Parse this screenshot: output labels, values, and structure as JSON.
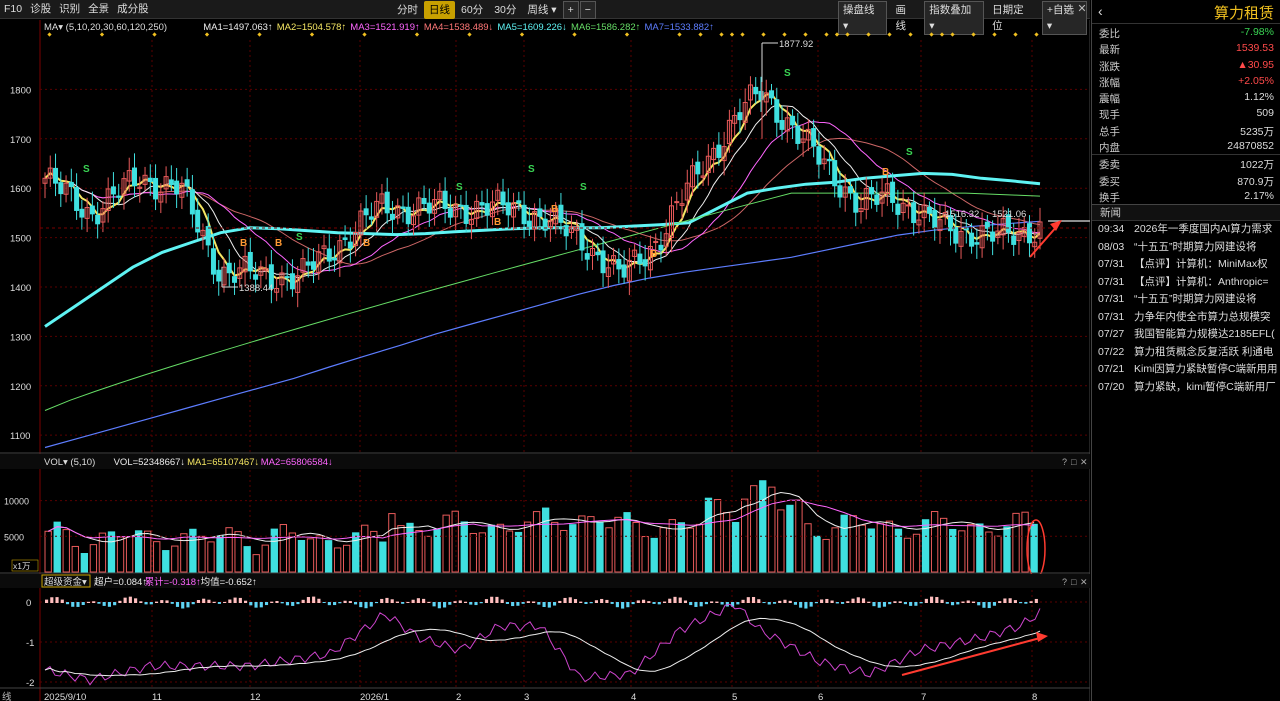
{
  "toolbar": {
    "left_items": [
      "F10",
      "诊股",
      "识别",
      "全景",
      "成分股"
    ],
    "periods": [
      {
        "label": "分时",
        "active": false
      },
      {
        "label": "日线",
        "active": true
      },
      {
        "label": "60分",
        "active": false
      },
      {
        "label": "30分",
        "active": false
      },
      {
        "label": "周线 ▾",
        "active": false
      },
      {
        "label": "+",
        "active": false,
        "box": true
      },
      {
        "label": "−",
        "active": false,
        "box": true
      }
    ],
    "right_items": [
      {
        "label": "操盘线 ▾",
        "box": true
      },
      {
        "label": "画线",
        "box": false
      },
      {
        "label": "指数叠加 ▾",
        "box": true
      },
      {
        "label": "日期定位",
        "box": false
      },
      {
        "label": "+自选 ▾",
        "box": true
      }
    ]
  },
  "panel": {
    "name": "算力租赁",
    "back_icon": "‹",
    "quote_groups": [
      [
        {
          "k": "委比",
          "v": "-7.98%",
          "c": "#39d353"
        },
        {
          "k": "最新",
          "v": "1539.53",
          "c": "#ff4a4a"
        },
        {
          "k": "涨跌",
          "v": "▲30.95",
          "c": "#ff4a4a"
        },
        {
          "k": "涨幅",
          "v": "+2.05%",
          "c": "#ff4a4a"
        },
        {
          "k": "震幅",
          "v": "1.12%",
          "c": "#ddd"
        },
        {
          "k": "现手",
          "v": "509",
          "c": "#ddd"
        },
        {
          "k": "总手",
          "v": "5235万",
          "c": "#ddd"
        },
        {
          "k": "内盘",
          "v": "24870852",
          "c": "#ddd"
        }
      ],
      [
        {
          "k": "委卖",
          "v": "1022万",
          "c": "#ddd"
        },
        {
          "k": "委买",
          "v": "870.9万",
          "c": "#ddd"
        },
        {
          "k": "换手",
          "v": "2.17%",
          "c": "#ddd"
        }
      ]
    ],
    "news_title": "新闻",
    "news": [
      {
        "t": "09:34",
        "h": "2026年一季度国内AI算力需求"
      },
      {
        "t": "08/03",
        "h": "“十五五”时期算力网建设将"
      },
      {
        "t": "07/31",
        "h": "【点评】计算机：MiniMax权"
      },
      {
        "t": "07/31",
        "h": "【点评】计算机：Anthropic="
      },
      {
        "t": "07/31",
        "h": "“十五五”时期算力网建设将"
      },
      {
        "t": "07/31",
        "h": "力争年内使全市算力总规模突"
      },
      {
        "t": "07/27",
        "h": "我国智能算力规模达2185EFL("
      },
      {
        "t": "07/22",
        "h": "算力租赁概念反复活跃 利通电"
      },
      {
        "t": "07/21",
        "h": "Kimi因算力紧缺暂停C端新用用"
      },
      {
        "t": "07/20",
        "h": "算力紧缺，kimi暂停C端新用厂"
      }
    ]
  },
  "ma_legend": {
    "label": "MA▾ (5,10,20,30,60,120,250)",
    "items": [
      {
        "text": "MA1=1497.063↑",
        "c": "#eeeeee"
      },
      {
        "text": "MA2=1504.578↑",
        "c": "#f5e663"
      },
      {
        "text": "MA3=1521.919↑",
        "c": "#ff66ff"
      },
      {
        "text": "MA4=1538.489↓",
        "c": "#ff7777"
      },
      {
        "text": "MA5=1609.226↓",
        "c": "#5ff3f3"
      },
      {
        "text": "MA6=1586.282↑",
        "c": "#66dd66"
      },
      {
        "text": "MA7=1533.882↑",
        "c": "#5d7dff"
      }
    ]
  },
  "vol_legend": {
    "label": "VOL▾ (5,10)",
    "items": [
      {
        "text": "VOL=52348667↓",
        "c": "#eeeeee"
      },
      {
        "text": "MA1=65107467↓",
        "c": "#f5e663"
      },
      {
        "text": "MA2=65806584↓",
        "c": "#ff66ff"
      }
    ],
    "unit": "x1万"
  },
  "ind_legend": {
    "label": "超级资金▾",
    "items": [
      {
        "text": "超户=0.084↑",
        "c": "#eeeeee"
      },
      {
        "text": "累计=-0.318↑",
        "c": "#ff66ff"
      },
      {
        "text": "均值=-0.652↑",
        "c": "#eeeeee"
      }
    ]
  },
  "price_axis": {
    "ticks": [
      "1800",
      "1700",
      "1600",
      "1500",
      "1400",
      "1300",
      "1200",
      "1100"
    ]
  },
  "vol_axis": {
    "ticks": [
      "10000",
      "5000"
    ]
  },
  "ind_axis": {
    "ticks": [
      "0",
      "-1",
      "-2"
    ]
  },
  "date_axis": {
    "labels": [
      "2025/9/10",
      "11",
      "12",
      "2026/1",
      "2",
      "3",
      "4",
      "5",
      "6",
      "7",
      "8"
    ]
  },
  "annotations": {
    "high": "1877.92",
    "low": "1388.44",
    "mid1": "1516.32",
    "mid2": "1521.06",
    "s_signal": "S",
    "b_signal": "B"
  },
  "colors": {
    "up": "#e85a5a",
    "down": "#3fe0e0",
    "accent": "#f0c020",
    "arrow": "#ff3b30",
    "grid": "#7a0000"
  },
  "chart_data": {
    "type": "candlestick",
    "ylim": [
      1070,
      1900
    ],
    "series": [
      {
        "name": "MA5",
        "values": [
          1320,
          1360,
          1400,
          1440,
          1470,
          1490,
          1510,
          1520,
          1518,
          1514,
          1510,
          1508,
          1506,
          1508,
          1512,
          1515,
          1518,
          1520,
          1520,
          1520,
          1523,
          1526,
          1530,
          1560,
          1590,
          1600,
          1608,
          1612,
          1620,
          1625,
          1630,
          1628,
          1620,
          1615,
          1609
        ]
      },
      {
        "name": "MA7",
        "values": [
          1075,
          1095,
          1115,
          1135,
          1155,
          1175,
          1195,
          1215,
          1238,
          1260,
          1282,
          1305,
          1325,
          1345,
          1365,
          1385,
          1403,
          1418,
          1430,
          1440,
          1450,
          1460,
          1475,
          1490,
          1505,
          1515,
          1522,
          1528,
          1533
        ]
      }
    ]
  }
}
